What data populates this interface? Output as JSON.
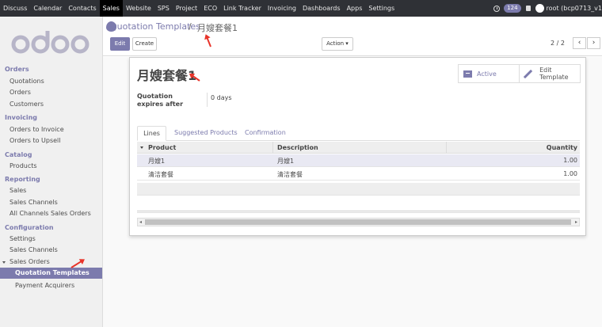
{
  "topbar": {
    "menu": [
      "Discuss",
      "Calendar",
      "Contacts",
      "Sales",
      "Website",
      "SPS",
      "Project",
      "ECO",
      "Link Tracker",
      "Invoicing",
      "Dashboards",
      "Apps",
      "Settings"
    ],
    "active_menu": "Sales",
    "notification_count": "124",
    "user_label": "root (bcp0713_v1"
  },
  "sidebar": {
    "logo_text": "odoo",
    "sections": [
      {
        "title": "Orders",
        "items": [
          "Quotations",
          "Orders",
          "Customers"
        ]
      },
      {
        "title": "Invoicing",
        "items": [
          "Orders to Invoice",
          "Orders to Upsell"
        ]
      },
      {
        "title": "Catalog",
        "items": [
          "Products"
        ]
      },
      {
        "title": "Reporting",
        "items": [
          "Sales",
          "Sales Channels",
          "All Channels Sales Orders"
        ]
      },
      {
        "title": "Configuration",
        "items": [
          "Settings",
          "Sales Channels",
          "Sales Orders"
        ]
      }
    ],
    "sales_orders_children": [
      "Quotation Templates",
      "Payment Acquirers"
    ],
    "active_item": "Quotation Templates"
  },
  "control_panel": {
    "breadcrumb_parent": "Quotation Templates",
    "breadcrumb_sep": "/",
    "breadcrumb_current": "月嫂套餐1",
    "edit_label": "Edit",
    "create_label": "Create",
    "action_label": "Action ▾",
    "pager": "2 / 2",
    "prev_label": "‹",
    "next_label": "›"
  },
  "form": {
    "title": "月嫂套餐1",
    "active_label": "Active",
    "edit_template_label": "Edit Template",
    "expires_label": "Quotation expires after",
    "expires_value": "0 days",
    "tabs": [
      "Lines",
      "Suggested Products",
      "Confirmation"
    ],
    "active_tab": "Lines",
    "columns": [
      "Product",
      "Description",
      "Quantity"
    ],
    "rows": [
      {
        "product": "月嫂1",
        "description": "月嫂1",
        "quantity": "1.00"
      },
      {
        "product": "清洁套餐",
        "description": "清洁套餐",
        "quantity": "1.00"
      }
    ]
  },
  "colors": {
    "brand": "#7c7bad",
    "topbar": "#2f3136",
    "annotation_arrow": "#e8342a"
  },
  "icons": [
    "clock-icon",
    "lock-icon",
    "archive-icon",
    "pencil-icon",
    "sort-caret-icon"
  ]
}
